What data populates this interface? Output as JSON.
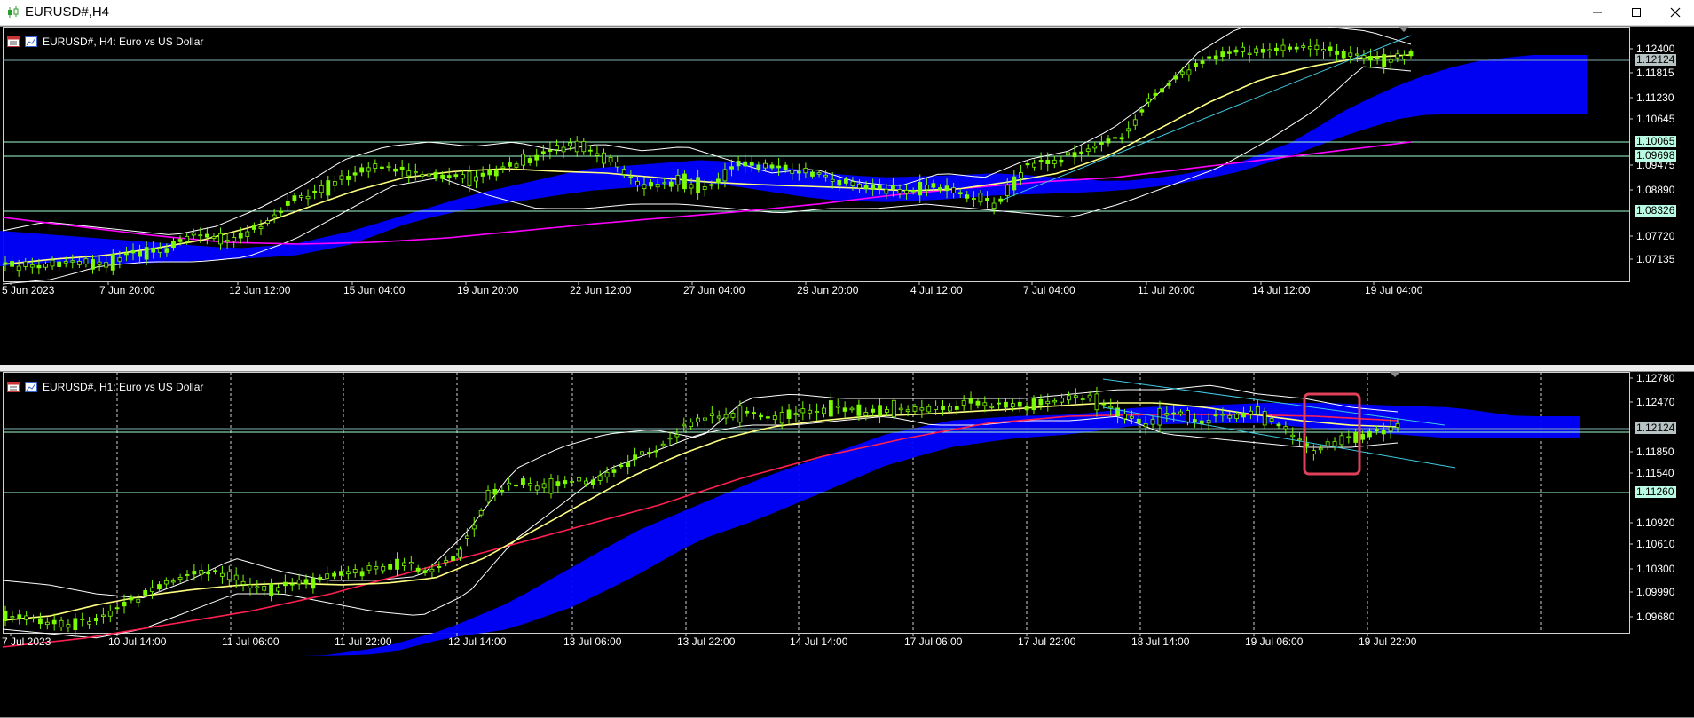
{
  "window": {
    "title": "EURUSD#,H4",
    "buttons": {
      "minimize": "minimize-icon",
      "maximize": "maximize-icon",
      "close": "close-icon"
    }
  },
  "panes": [
    {
      "id": "h4",
      "label": "EURUSD#, H4:  Euro vs US Dollar",
      "price_ticks": [
        "1.12400",
        "1.11815",
        "1.11230",
        "1.10645",
        "1.09475",
        "1.08890",
        "1.07720",
        "1.07135"
      ],
      "price_tags": [
        {
          "text": "1.12124",
          "color": "#b8c4c4"
        },
        {
          "text": "1.10065",
          "color": "#b9fbe3"
        },
        {
          "text": "1.09698",
          "color": "#b9fbe3"
        },
        {
          "text": "1.08326",
          "color": "#b9fbe3"
        }
      ],
      "time_ticks": [
        "5 Jun 2023",
        "7 Jun 20:00",
        "12 Jun 12:00",
        "15 Jun 04:00",
        "19 Jun 20:00",
        "22 Jun 12:00",
        "27 Jun 04:00",
        "29 Jun 20:00",
        "4 Jul 12:00",
        "7 Jul 04:00",
        "11 Jul 20:00",
        "14 Jul 12:00",
        "19 Jul 04:00"
      ]
    },
    {
      "id": "h1",
      "label": "EURUSD#, H1:  Euro vs US Dollar",
      "price_ticks": [
        "1.12780",
        "1.12470",
        "1.11850",
        "1.11540",
        "1.10920",
        "1.10610",
        "1.10300",
        "1.09990",
        "1.09680"
      ],
      "price_tags": [
        {
          "text": "1.12124",
          "color": "#b8c4c4"
        },
        {
          "text": "1.11260",
          "color": "#b9fbe3"
        }
      ],
      "time_ticks": [
        "7 Jul 2023",
        "10 Jul 14:00",
        "11 Jul 06:00",
        "11 Jul 22:00",
        "12 Jul 14:00",
        "13 Jul 06:00",
        "13 Jul 22:00",
        "14 Jul 14:00",
        "17 Jul 06:00",
        "17 Jul 22:00",
        "18 Jul 14:00",
        "19 Jul 06:00",
        "19 Jul 22:00"
      ]
    }
  ],
  "colors": {
    "background": "#000000",
    "candle": "#7cfc00",
    "ma_fast": "#ffff80",
    "ma_slow": "#ff00ff",
    "ma_slow_h1": "#ff2050",
    "bollinger": "#ffffff",
    "cloud": "#0000ff",
    "hlines": "#9fffd0",
    "trendline": "#40c8e0",
    "highlight_box": "#e0405a"
  }
}
